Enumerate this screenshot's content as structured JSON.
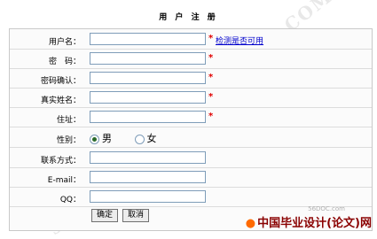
{
  "title": "用 户 注 册",
  "fields": [
    {
      "label": "用户名：",
      "value": "",
      "required": true
    },
    {
      "label": "密　码：",
      "value": "",
      "required": true
    },
    {
      "label": "密码确认：",
      "value": "",
      "required": true
    },
    {
      "label": "真实姓名：",
      "value": "",
      "required": true
    },
    {
      "label": "住址：",
      "value": "",
      "required": true
    }
  ],
  "check_link": "检测是否可用",
  "required_mark": "*",
  "gender": {
    "label": "性别：",
    "options": [
      "男",
      "女"
    ],
    "selected": "男"
  },
  "contact_fields": [
    {
      "label": "联系方式：",
      "value": ""
    },
    {
      "label": "E-mail：",
      "value": ""
    },
    {
      "label": "QQ：",
      "value": ""
    }
  ],
  "buttons": {
    "confirm": "确定",
    "cancel": "取消"
  },
  "brand": {
    "url": "56DOC.com",
    "name": "中国毕业设计(论文)网",
    "logo": "china-graduation-logo-icon"
  }
}
